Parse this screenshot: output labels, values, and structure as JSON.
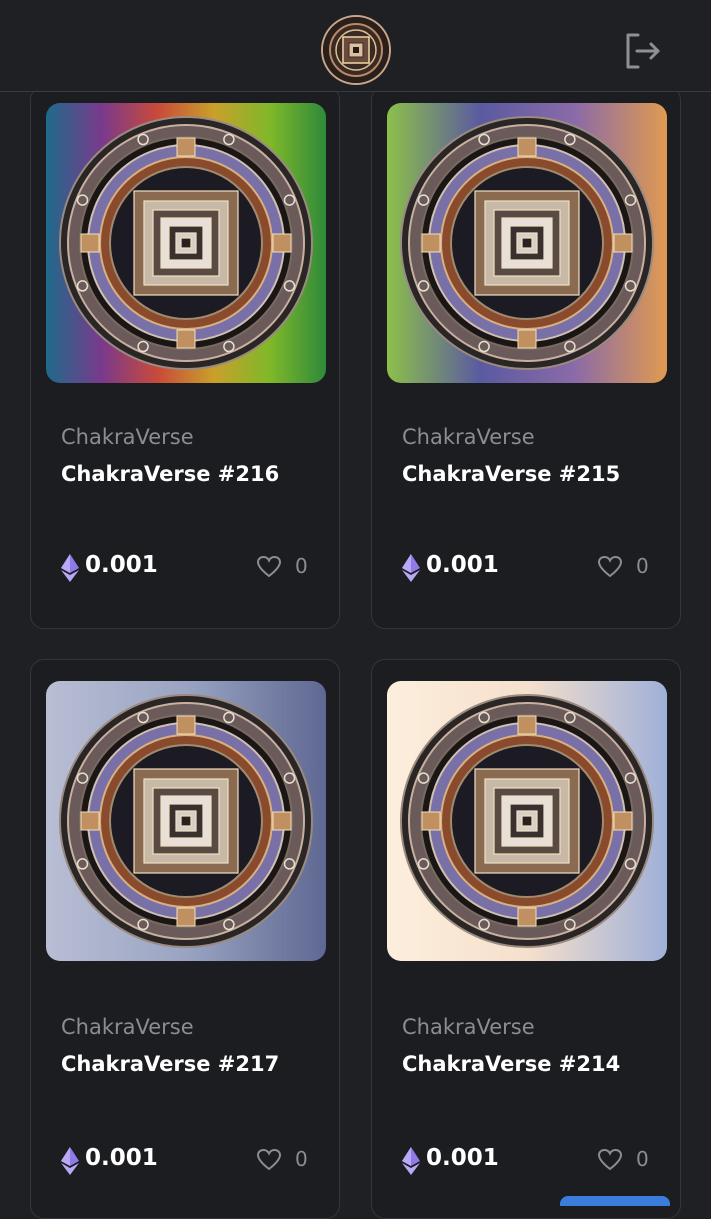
{
  "header": {
    "avatar_icon": "mandala-avatar-icon",
    "logout_icon": "logout-icon"
  },
  "cards": [
    {
      "collection": "ChakraVerse",
      "title": "ChakraVerse #216",
      "price": "0.001",
      "likes": "0",
      "bg": [
        "#1f6a8a",
        "#7a3a8c",
        "#c94a3a",
        "#c9a02a",
        "#7fb82a",
        "#2e8a3a"
      ]
    },
    {
      "collection": "ChakraVerse",
      "title": "ChakraVerse #215",
      "price": "0.001",
      "likes": "0",
      "bg": [
        "#8cc04a",
        "#5a5aa0",
        "#8a6aa8",
        "#e09a50"
      ]
    },
    {
      "collection": "ChakraVerse",
      "title": "ChakraVerse #217",
      "price": "0.001",
      "likes": "0",
      "bg": [
        "#b8bed4",
        "#9aa4c2",
        "#5e6892"
      ]
    },
    {
      "collection": "ChakraVerse",
      "title": "ChakraVerse #214",
      "price": "0.001",
      "likes": "0",
      "bg": [
        "#fdeedd",
        "#f5e0cc",
        "#9fb0d8"
      ]
    }
  ]
}
